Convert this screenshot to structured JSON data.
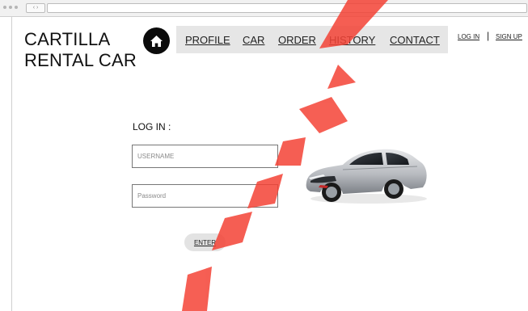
{
  "brand": {
    "line1": "CARTILLA",
    "line2": "RENTAL CAR"
  },
  "nav": {
    "items": [
      "PROFILE",
      "CAR",
      "ORDER",
      "HISTORY",
      "CONTACT"
    ]
  },
  "auth": {
    "login": "LOG IN",
    "separator": "|",
    "signup": "SIGN UP"
  },
  "login_form": {
    "title": "LOG IN :",
    "username_placeholder": "USERNAME",
    "password_placeholder": "Password",
    "enter_label": "ENTER"
  },
  "browser": {
    "nav_buttons": "‹ ›"
  },
  "icons": {
    "home": "home-icon",
    "car": "car-image"
  },
  "colors": {
    "nav_bg": "#e6e6e6",
    "home_bg": "#0b0b0b",
    "button_bg": "#e3e3e3",
    "watermark": "#f44336"
  }
}
